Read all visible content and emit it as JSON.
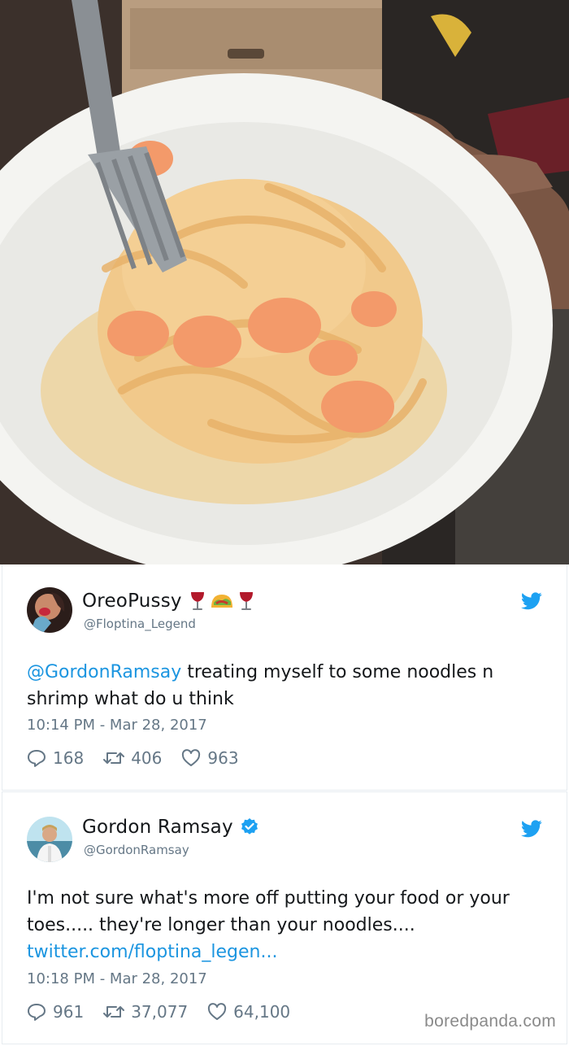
{
  "photo": {
    "subject": "plate of fettuccine with shrimp in creamy sauce, fork, and a hand with dirty toes visible"
  },
  "tweets": [
    {
      "display_name": "OreoPussy",
      "emoji_icons": [
        "wine-glass-icon",
        "taco-icon",
        "wine-glass-icon"
      ],
      "handle": "@Floptina_Legend",
      "mention": "@GordonRamsay",
      "text": " treating myself to some noodles n shrimp what do u think",
      "timestamp": "10:14 PM - Mar 28, 2017",
      "replies": "168",
      "retweets": "406",
      "likes": "963"
    },
    {
      "display_name": "Gordon Ramsay",
      "verified": true,
      "handle": "@GordonRamsay",
      "text": "I'm not sure what's more off putting your food or your toes..... they're longer than your noodles....",
      "link": "twitter.com/floptina_legen...",
      "timestamp": "10:18 PM - Mar 28, 2017",
      "replies": "961",
      "retweets": "37,077",
      "likes": "64,100"
    }
  ],
  "watermark": "boredpanda.com",
  "colors": {
    "twitter_blue": "#1da1f2",
    "link_blue": "#1b95e0",
    "meta_gray": "#657786"
  }
}
